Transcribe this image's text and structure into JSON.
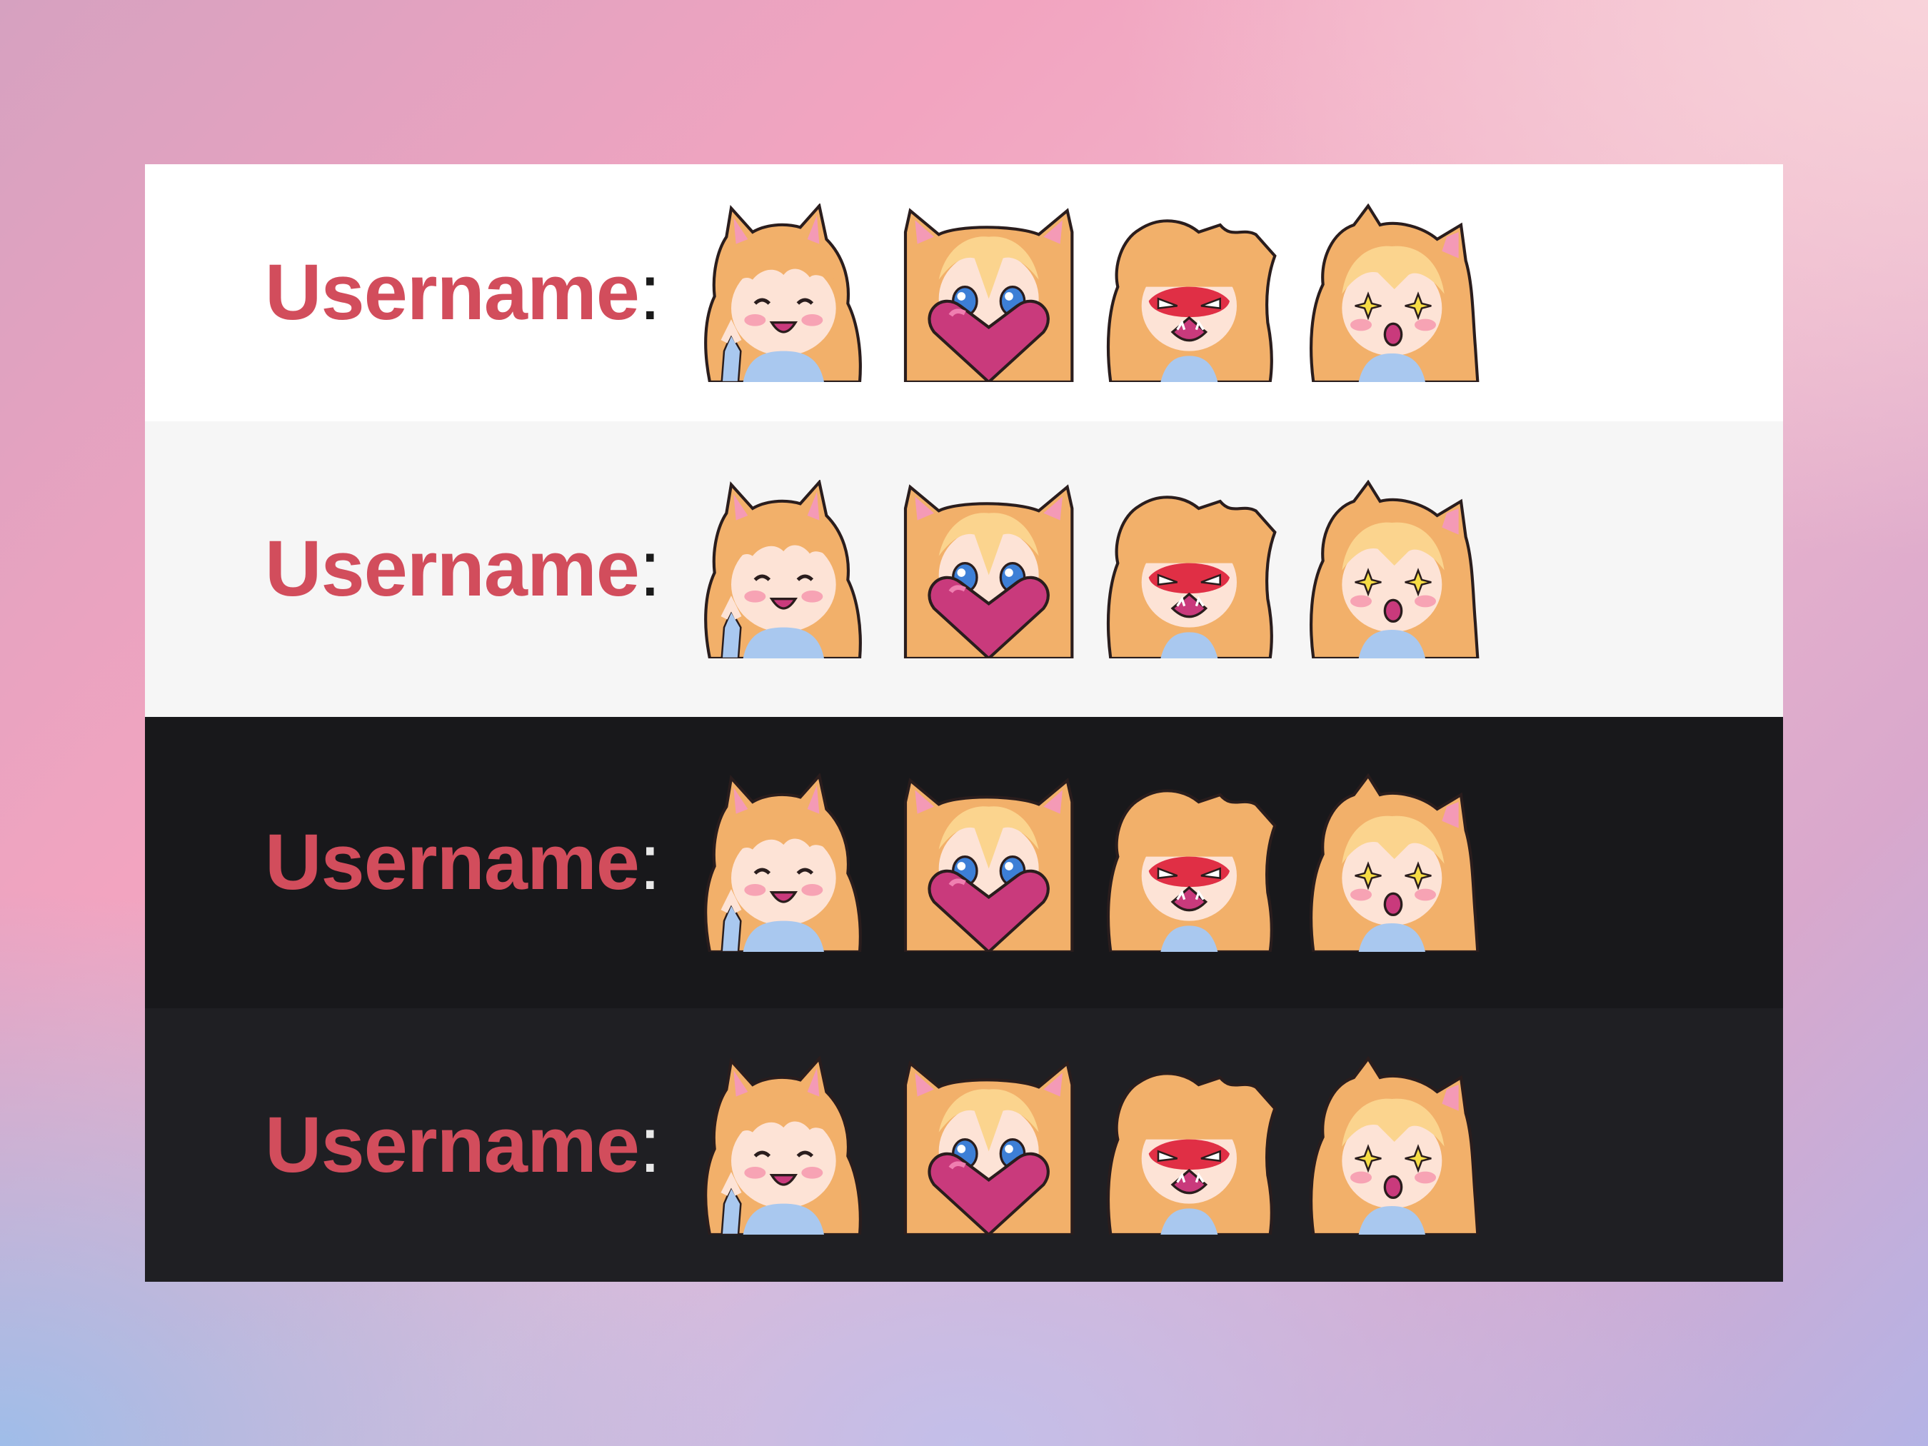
{
  "rows": [
    {
      "theme": "white",
      "background": "#ffffff",
      "username": "Username",
      "colon": ":",
      "colon_color": "#1a1a1a",
      "emotes": [
        "cat-girl-wave-emote",
        "cat-girl-heart-emote",
        "cat-girl-rage-emote",
        "cat-girl-starstruck-emote"
      ]
    },
    {
      "theme": "light-gray",
      "background": "#f6f6f6",
      "username": "Username",
      "colon": ":",
      "colon_color": "#1a1a1a",
      "emotes": [
        "cat-girl-wave-emote",
        "cat-girl-heart-emote",
        "cat-girl-rage-emote",
        "cat-girl-starstruck-emote"
      ]
    },
    {
      "theme": "black",
      "background": "#18181b",
      "username": "Username",
      "colon": ":",
      "colon_color": "#e8e8e8",
      "emotes": [
        "cat-girl-wave-emote",
        "cat-girl-heart-emote",
        "cat-girl-rage-emote",
        "cat-girl-starstruck-emote"
      ]
    },
    {
      "theme": "dark-gray",
      "background": "#1f1f23",
      "username": "Username",
      "colon": ":",
      "colon_color": "#e8e8e8",
      "emotes": [
        "cat-girl-wave-emote",
        "cat-girl-heart-emote",
        "cat-girl-rage-emote",
        "cat-girl-starstruck-emote"
      ]
    }
  ],
  "colors": {
    "username": "#d24d5c",
    "hair": "#f2b06a",
    "hair_highlight": "#fbd48e",
    "skin": "#fde3d6",
    "blush": "#f7a3b4",
    "ear_inner": "#f49ab6",
    "shirt": "#a9c8ef",
    "heart": "#c93a7c",
    "eye_blue": "#3d7fd6",
    "star_yellow": "#f7dd45",
    "rage_red": "#e02f45",
    "outline": "#2a1d1d"
  }
}
